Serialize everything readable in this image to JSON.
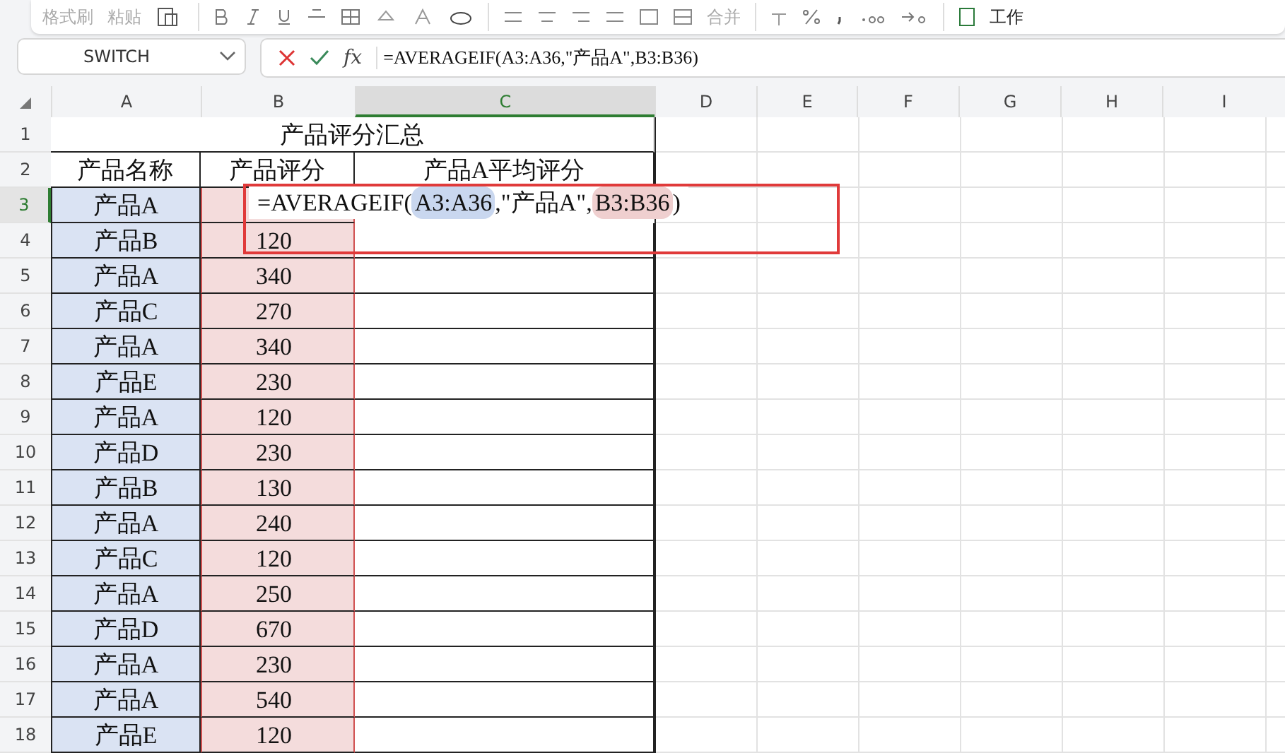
{
  "toolbar": {
    "labels": [
      "格式刷",
      "粘贴",
      "合并",
      "工作"
    ]
  },
  "name_box": {
    "value": "SWITCH"
  },
  "formula_bar": {
    "function_label": "fx",
    "value": "=AVERAGEIF(A3:A36,\"产品A\",B3:B36)"
  },
  "columns": [
    {
      "label": "A",
      "selected": false
    },
    {
      "label": "B",
      "selected": false
    },
    {
      "label": "C",
      "selected": true
    },
    {
      "label": "D",
      "selected": false
    },
    {
      "label": "E",
      "selected": false
    },
    {
      "label": "F",
      "selected": false
    },
    {
      "label": "G",
      "selected": false
    },
    {
      "label": "H",
      "selected": false
    },
    {
      "label": "I",
      "selected": false
    }
  ],
  "title_row": {
    "number": "1",
    "selected": false,
    "text": "产品评分汇总"
  },
  "header_row": {
    "number": "2",
    "selected": false,
    "cells": [
      "产品名称",
      "产品评分",
      "产品A平均评分"
    ]
  },
  "data_rows": [
    {
      "number": "3",
      "selected": true,
      "name": "产品A"
    },
    {
      "number": "4",
      "selected": false,
      "name": "产品B",
      "score": "120"
    },
    {
      "number": "5",
      "selected": false,
      "name": "产品A",
      "score": "340"
    },
    {
      "number": "6",
      "selected": false,
      "name": "产品C",
      "score": "270"
    },
    {
      "number": "7",
      "selected": false,
      "name": "产品A",
      "score": "340"
    },
    {
      "number": "8",
      "selected": false,
      "name": "产品E",
      "score": "230"
    },
    {
      "number": "9",
      "selected": false,
      "name": "产品A",
      "score": "120"
    },
    {
      "number": "10",
      "selected": false,
      "name": "产品D",
      "score": "230"
    },
    {
      "number": "11",
      "selected": false,
      "name": "产品B",
      "score": "130"
    },
    {
      "number": "12",
      "selected": false,
      "name": "产品A",
      "score": "240"
    },
    {
      "number": "13",
      "selected": false,
      "name": "产品C",
      "score": "120"
    },
    {
      "number": "14",
      "selected": false,
      "name": "产品A",
      "score": "250"
    },
    {
      "number": "15",
      "selected": false,
      "name": "产品D",
      "score": "670"
    },
    {
      "number": "16",
      "selected": false,
      "name": "产品A",
      "score": "230"
    },
    {
      "number": "17",
      "selected": false,
      "name": "产品A",
      "score": "540"
    },
    {
      "number": "18",
      "selected": false,
      "name": "产品E",
      "score": "120"
    }
  ],
  "cell_editor": {
    "parts": [
      {
        "kind": "text",
        "text": "=AVERAGEIF("
      },
      {
        "kind": "ref",
        "text": "A3:A36",
        "color": "#c9d7ef"
      },
      {
        "kind": "text",
        "text": ",\"产品A\","
      },
      {
        "kind": "ref",
        "text": "B3:B36",
        "color": "#efcfcf"
      },
      {
        "kind": "text",
        "text": ")"
      }
    ]
  }
}
